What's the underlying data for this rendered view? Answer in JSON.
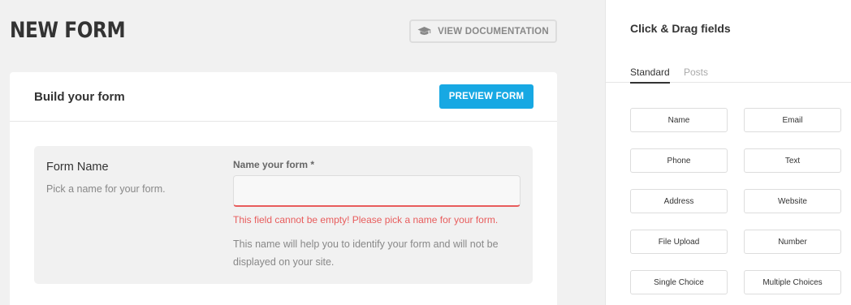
{
  "main": {
    "page_title": "NEW FORM",
    "doc_button_label": "VIEW DOCUMENTATION",
    "doc_button_icon": "graduation-cap-icon",
    "card": {
      "title": "Build your form",
      "preview_button_label": "PREVIEW FORM",
      "preview_button_color": "#17a8e3",
      "form_name": {
        "label": "Form Name",
        "description": "Pick a name for your form.",
        "field_label": "Name your form *",
        "value": "",
        "error": "This field cannot be empty! Please pick a name for your form.",
        "error_color": "#e85c5c",
        "help": "This name will help you to identify your form and will not be displayed on your site."
      }
    }
  },
  "sidebar": {
    "title": "Click & Drag fields",
    "tabs": [
      {
        "label": "Standard",
        "active": true
      },
      {
        "label": "Posts",
        "active": false
      }
    ],
    "fields": [
      "Name",
      "Email",
      "Phone",
      "Text",
      "Address",
      "Website",
      "File Upload",
      "Number",
      "Single Choice",
      "Multiple Choices"
    ]
  }
}
